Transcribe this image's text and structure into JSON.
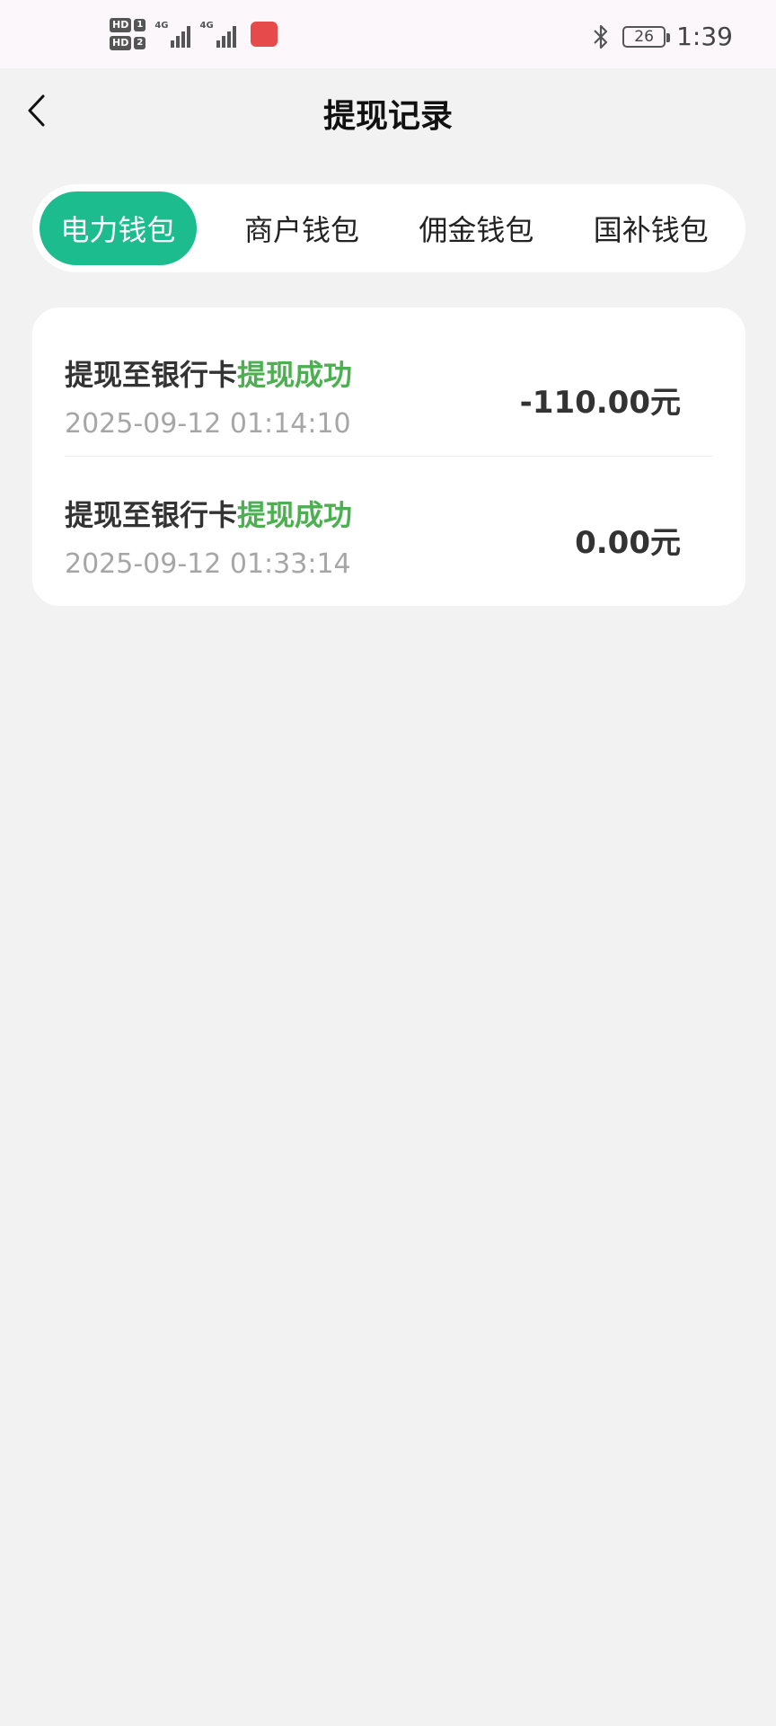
{
  "status_bar": {
    "sim1_label": "HD",
    "sim1_num": "1",
    "sim2_label": "HD",
    "sim2_num": "2",
    "network1": "4G",
    "network2": "4G",
    "battery": "26",
    "time": "1:39",
    "icons": [
      "bluetooth-icon",
      "battery-icon",
      "signal-icon"
    ]
  },
  "header": {
    "title": "提现记录",
    "back_icon": "chevron-left-icon"
  },
  "tabs": [
    {
      "label": "电力钱包",
      "active": true
    },
    {
      "label": "商户钱包",
      "active": false
    },
    {
      "label": "佣金钱包",
      "active": false
    },
    {
      "label": "国补钱包",
      "active": false
    }
  ],
  "records": [
    {
      "title": "提现至银行卡",
      "status": "提现成功",
      "time": "2025-09-12 01:14:10",
      "amount": "-110.00元"
    },
    {
      "title": "提现至银行卡",
      "status": "提现成功",
      "time": "2025-09-12 01:33:14",
      "amount": "0.00元"
    }
  ],
  "colors": {
    "accent": "#1dbc8e",
    "success": "#4caf50",
    "background": "#f2f2f2"
  }
}
